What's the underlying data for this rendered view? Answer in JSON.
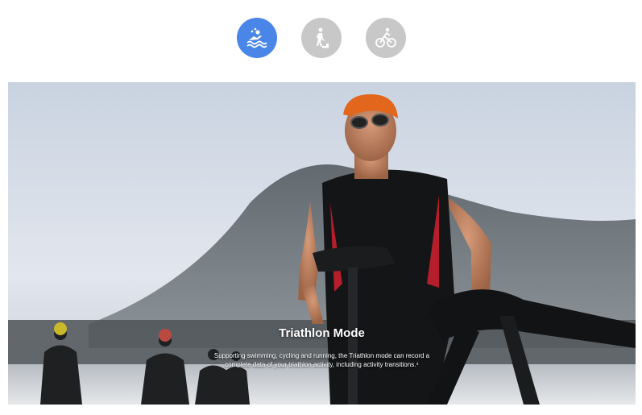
{
  "modes": [
    {
      "icon": "swim-icon",
      "active": true
    },
    {
      "icon": "run-icon",
      "active": false
    },
    {
      "icon": "bike-icon",
      "active": false
    }
  ],
  "colors": {
    "active": "#4a86e8",
    "inactive": "#c8c8c8",
    "icon_glyph": "#ffffff"
  },
  "feature": {
    "title": "Triathlon Mode",
    "description": "Supporting swimming, cycling and running, the Triathlon mode can record a complete data of your triathlon activity, including activity transitions.⁴"
  }
}
